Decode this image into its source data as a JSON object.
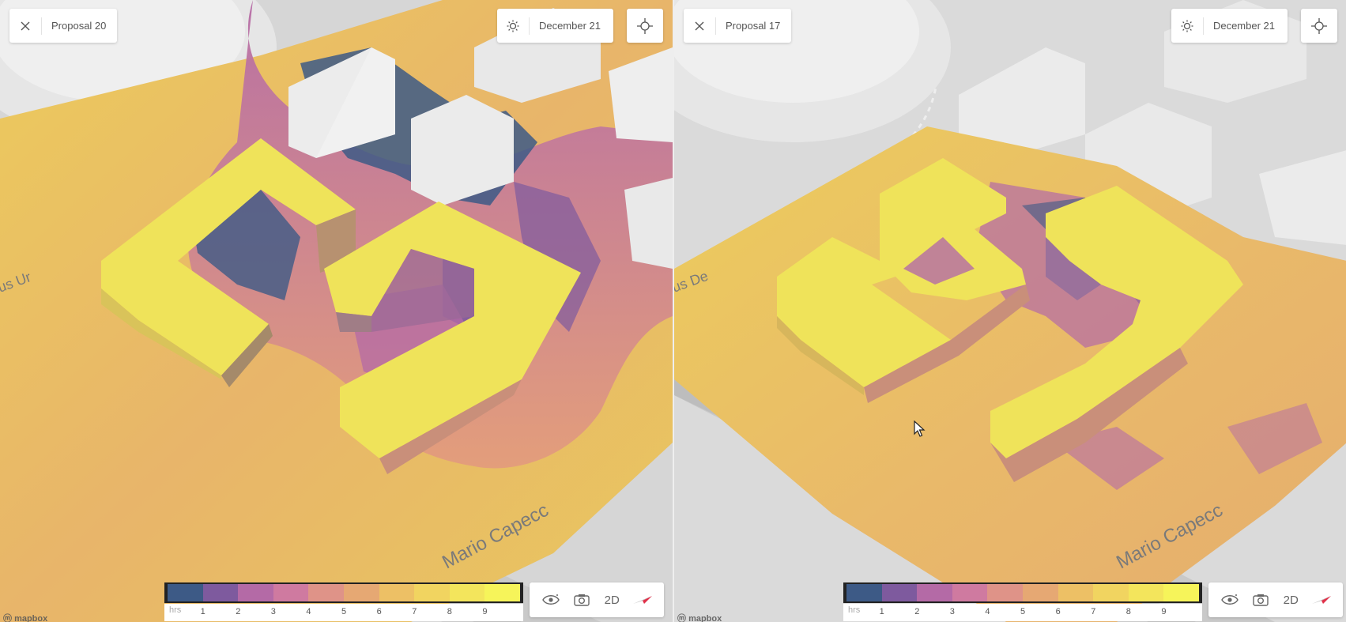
{
  "left": {
    "proposal": "Proposal 20",
    "date": "December 21"
  },
  "right": {
    "proposal": "Proposal 17",
    "date": "December 21"
  },
  "legend": {
    "unit": "hrs",
    "ticks": [
      "1",
      "2",
      "3",
      "4",
      "5",
      "6",
      "7",
      "8",
      "9"
    ],
    "colors": [
      "#3d5a86",
      "#7e5a9e",
      "#b46aa6",
      "#cf7aa0",
      "#df9388",
      "#e6a873",
      "#edc065",
      "#f1d460",
      "#f3e55c",
      "#f6f45a"
    ]
  },
  "toolbar": {
    "view_mode": "2D"
  },
  "attribution": "mapbox",
  "icons": {
    "close": "close-icon",
    "sun": "sun-icon",
    "locate": "crosshair-icon",
    "eye": "eye-icon",
    "camera": "camera-icon",
    "compass": "compass-icon"
  },
  "street_labels": {
    "left_street_1": "Mario Capecc",
    "left_street_2": "us Ur",
    "right_street_1": "Mario Capecc",
    "right_street_2": "us De"
  },
  "colors": {
    "map_bg": "#d9d9d9",
    "building": "#e9e9e9",
    "sun_high": "#f3e55c",
    "sun_low": "#3d5a86"
  }
}
